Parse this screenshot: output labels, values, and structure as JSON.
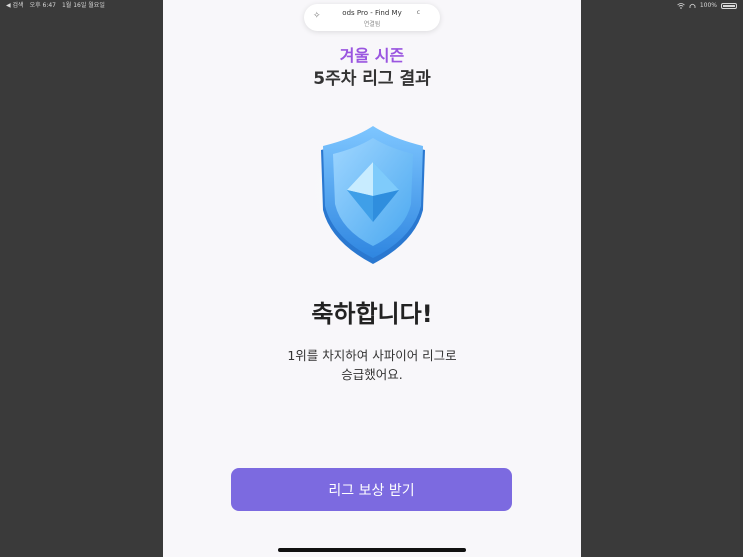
{
  "status_bar": {
    "back_label": "◀ 검색",
    "time": "오후 6:47",
    "date": "1월 16일 월요일",
    "battery": "100%",
    "battery_level": 1.0,
    "icons": [
      "wifi-icon",
      "headphones-icon",
      "battery-icon"
    ]
  },
  "notification": {
    "title": "ods Pro - Find My",
    "subtitle": "연결됨",
    "extra": "c"
  },
  "header": {
    "season": "겨울 시즌",
    "week_result": "5주차 리그 결과"
  },
  "badge": {
    "icon": "sapphire-shield-icon",
    "color": "#4aa8f0"
  },
  "message": {
    "title": "축하합니다!",
    "line1": "1위를 차지하여 사파이어 리그로",
    "line2": "승급했어요."
  },
  "button": {
    "label": "리그 보상 받기",
    "color": "#7c6ae0"
  },
  "colors": {
    "accent": "#9a55e0",
    "background": "#f8f7fa"
  }
}
